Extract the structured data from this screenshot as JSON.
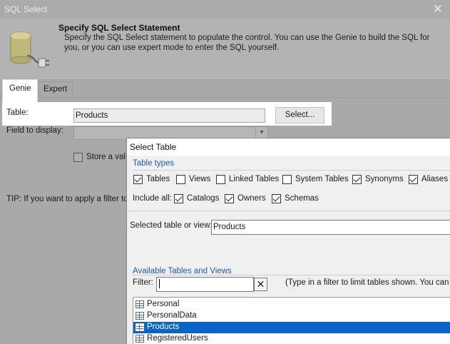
{
  "sql_window": {
    "title": "SQL Select",
    "header": {
      "title": "Specify SQL Select Statement",
      "description": "Specify the SQL Select statement to populate the control. You can use the Genie to build the SQL for you, or you can use expert mode to enter the SQL yourself."
    },
    "tabs": [
      {
        "label": "Genie",
        "active": true
      },
      {
        "label": "Expert",
        "active": false
      }
    ],
    "table_label": "Table:",
    "table_value": "Products",
    "select_button": "Select...",
    "field_label": "Field to display:",
    "field_value": "",
    "store_label": "Store a valu",
    "tip": "TIP: If you want to apply a filter to"
  },
  "select_table_dialog": {
    "title": "Select Table",
    "table_types_title": "Table types",
    "table_types": [
      {
        "label": "Tables",
        "checked": true
      },
      {
        "label": "Views",
        "checked": false
      },
      {
        "label": "Linked Tables",
        "checked": false
      },
      {
        "label": "System Tables",
        "checked": false
      },
      {
        "label": "Synonyms",
        "checked": true
      },
      {
        "label": "Aliases",
        "checked": true
      }
    ],
    "include_all_label": "Include all:",
    "include_all": [
      {
        "label": "Catalogs",
        "checked": true
      },
      {
        "label": "Owners",
        "checked": true
      },
      {
        "label": "Schemas",
        "checked": true
      }
    ],
    "selected_label": "Selected table or view:",
    "selected_value": "Products",
    "available_title": "Available Tables and Views",
    "filter_label": "Filter:",
    "filter_value": "",
    "filter_clear": "✕",
    "filter_hint": "(Type in a filter to limit tables shown. You can us",
    "tables": [
      {
        "name": "Personal",
        "selected": false
      },
      {
        "name": "PersonalData",
        "selected": false
      },
      {
        "name": "Products",
        "selected": true
      },
      {
        "name": "RegisteredUsers",
        "selected": false
      }
    ]
  },
  "colors": {
    "selection": "#0a63c9",
    "group_title": "#1e5ba8",
    "disabled_overlay": "#a9a9a9"
  },
  "icons": {
    "header": "database-plug-icon",
    "list_item": "table-icon"
  }
}
